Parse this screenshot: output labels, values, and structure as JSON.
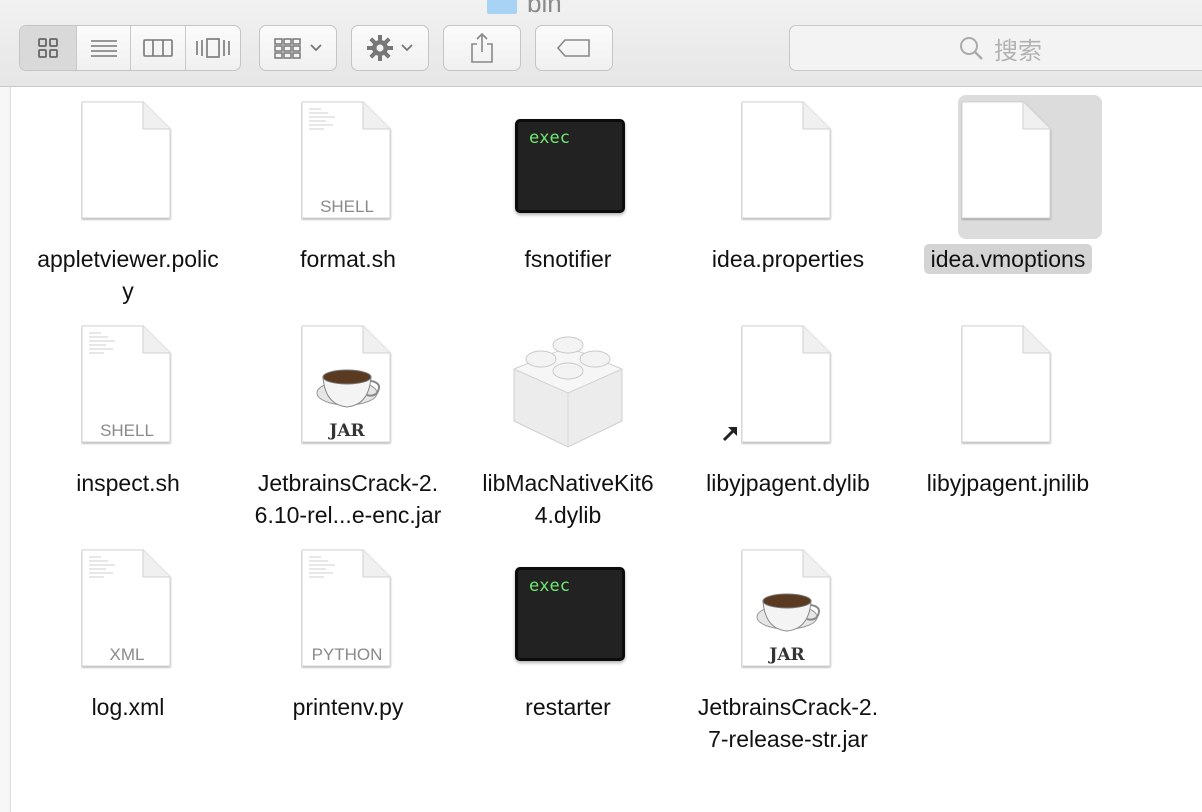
{
  "window": {
    "title": "bin"
  },
  "search": {
    "placeholder": "搜索"
  },
  "toolbar": {
    "view_modes": [
      "icon-view-icon",
      "list-view-icon",
      "column-view-icon",
      "coverflow-view-icon"
    ],
    "arrange": "arrange-icon",
    "action": "gear-icon",
    "share": "share-icon",
    "tags": "tag-icon"
  },
  "files": [
    {
      "name": "appletviewer.polic",
      "name2": "y",
      "kind": "blank"
    },
    {
      "name": "format.sh",
      "name2": "",
      "kind": "text",
      "badge": "SHELL"
    },
    {
      "name": "fsnotifier",
      "name2": "",
      "kind": "exec",
      "badge": "exec"
    },
    {
      "name": "idea.properties",
      "name2": "",
      "kind": "blank"
    },
    {
      "name": "idea.vmoptions",
      "name2": "",
      "kind": "blank",
      "selected": true
    },
    {
      "name": "inspect.sh",
      "name2": "",
      "kind": "text",
      "badge": "SHELL"
    },
    {
      "name": "JetbrainsCrack-2.",
      "name2": "6.10-rel...e-enc.jar",
      "kind": "jar",
      "badge": "JAR"
    },
    {
      "name": "libMacNativeKit6",
      "name2": "4.dylib",
      "kind": "lib"
    },
    {
      "name": "libyjpagent.dylib",
      "name2": "",
      "kind": "alias"
    },
    {
      "name": "libyjpagent.jnilib",
      "name2": "",
      "kind": "blank"
    },
    {
      "name": "log.xml",
      "name2": "",
      "kind": "text",
      "badge": "XML"
    },
    {
      "name": "printenv.py",
      "name2": "",
      "kind": "text",
      "badge": "PYTHON"
    },
    {
      "name": "restarter",
      "name2": "",
      "kind": "exec",
      "badge": "exec"
    },
    {
      "name": "JetbrainsCrack-2.",
      "name2": "7-release-str.jar",
      "kind": "jar",
      "badge": "JAR"
    }
  ],
  "colors": {
    "selection": "#d4d4d4",
    "exec_text": "#6ee86e",
    "folder": "#a8d3f5"
  }
}
